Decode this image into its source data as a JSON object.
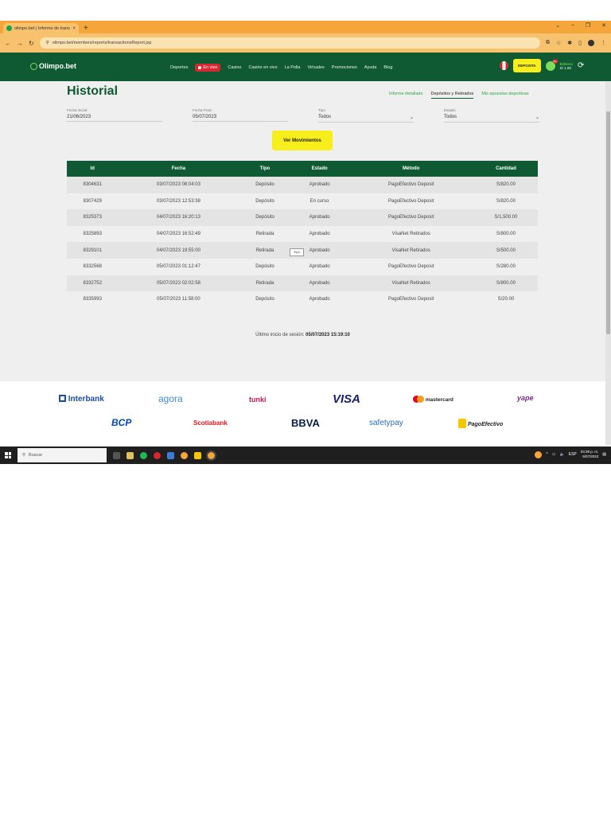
{
  "browser": {
    "tab_title": "olimpo.bet | Informe de transacc",
    "tab_close": "×",
    "new_tab": "+",
    "url": "olimpo.bet/members/reports/transactionsReport.jsp",
    "window_controls": [
      "⌄",
      "–",
      "❐",
      "✕"
    ]
  },
  "header": {
    "logo": "Olimpo.bet",
    "nav": [
      "Deportes",
      "En vivo",
      "Casino",
      "Casino en vivo",
      "La Polla",
      "Virtuales",
      "Promociones",
      "Ayuda",
      "Blog"
    ],
    "deposit_label": "DEPOSITA",
    "balance_label": "Billetera",
    "balance_value": "S/ 1.00",
    "badge": "99+"
  },
  "page": {
    "title": "Historial",
    "subtabs": [
      "Informe detallado",
      "Depósitos y Retirados",
      "Mis apuestas deportivas"
    ],
    "active_subtab": 1,
    "filters": {
      "fecha_inicial_label": "Fecha inicial:",
      "fecha_inicial_value": "21/06/2023",
      "fecha_final_label": "Fecha Final:",
      "fecha_final_value": "05/07/2023",
      "tipo_label": "Tipo:",
      "tipo_value": "Todos",
      "estado_label": "Estado:",
      "estado_value": "Todos"
    },
    "button": "Ver Movimientos",
    "tooltip": "Tipo",
    "last_login_label": "Último inicio de sesión:",
    "last_login_value": "05/07/2023 15:19:10"
  },
  "table": {
    "columns": [
      "Id",
      "Fecha",
      "Tipo",
      "Estado",
      "Método",
      "Cantidad"
    ],
    "rows": [
      [
        "8304631",
        "03/07/2023 08:04:03",
        "Depósito",
        "Aprobado",
        "PagoEfectivo Deposit",
        "S/820.00"
      ],
      [
        "8307429",
        "03/07/2023 12:53:38",
        "Depósito",
        "En curso",
        "PagoEfectivo Deposit",
        "S/820.00"
      ],
      [
        "8325373",
        "04/07/2023 16:20:13",
        "Depósito",
        "Aprobado",
        "PagoEfectivo Deposit",
        "S/1,500.00"
      ],
      [
        "8325893",
        "04/07/2023 16:52:49",
        "Retirada",
        "Aprobado",
        "VisaNet Retirados",
        "S/800.00"
      ],
      [
        "8329101",
        "04/07/2023 19:55:00",
        "Retirada",
        "Aprobado",
        "VisaNet Retirados",
        "S/500.00"
      ],
      [
        "8332568",
        "05/07/2023 01:12:47",
        "Depósito",
        "Aprobado",
        "PagoEfectivo Deposit",
        "S/280.00"
      ],
      [
        "8332752",
        "05/07/2023 02:02:58",
        "Retirada",
        "Aprobado",
        "VisaNet Retirados",
        "S/800.00"
      ],
      [
        "8335993",
        "05/07/2023 11:58:00",
        "Depósito",
        "Aprobado",
        "PagoEfectivo Deposit",
        "S/20.00"
      ]
    ]
  },
  "footer": {
    "logos": [
      "Interbank",
      "agora",
      "tunki",
      "VISA",
      "mastercard",
      "yape",
      "BCP",
      "Scotiabank",
      "BBVA",
      "safetypay",
      "PagoEfectivo"
    ]
  },
  "taskbar": {
    "search_placeholder": "Buscar",
    "lang": "ESP",
    "time": "03:39 p. m.",
    "date": "5/07/2023"
  },
  "colors": {
    "brand_green": "#0f5a32",
    "accent_yellow": "#f7ee1c",
    "live_red": "#d8272f",
    "chrome_orange": "#f5a63a"
  }
}
